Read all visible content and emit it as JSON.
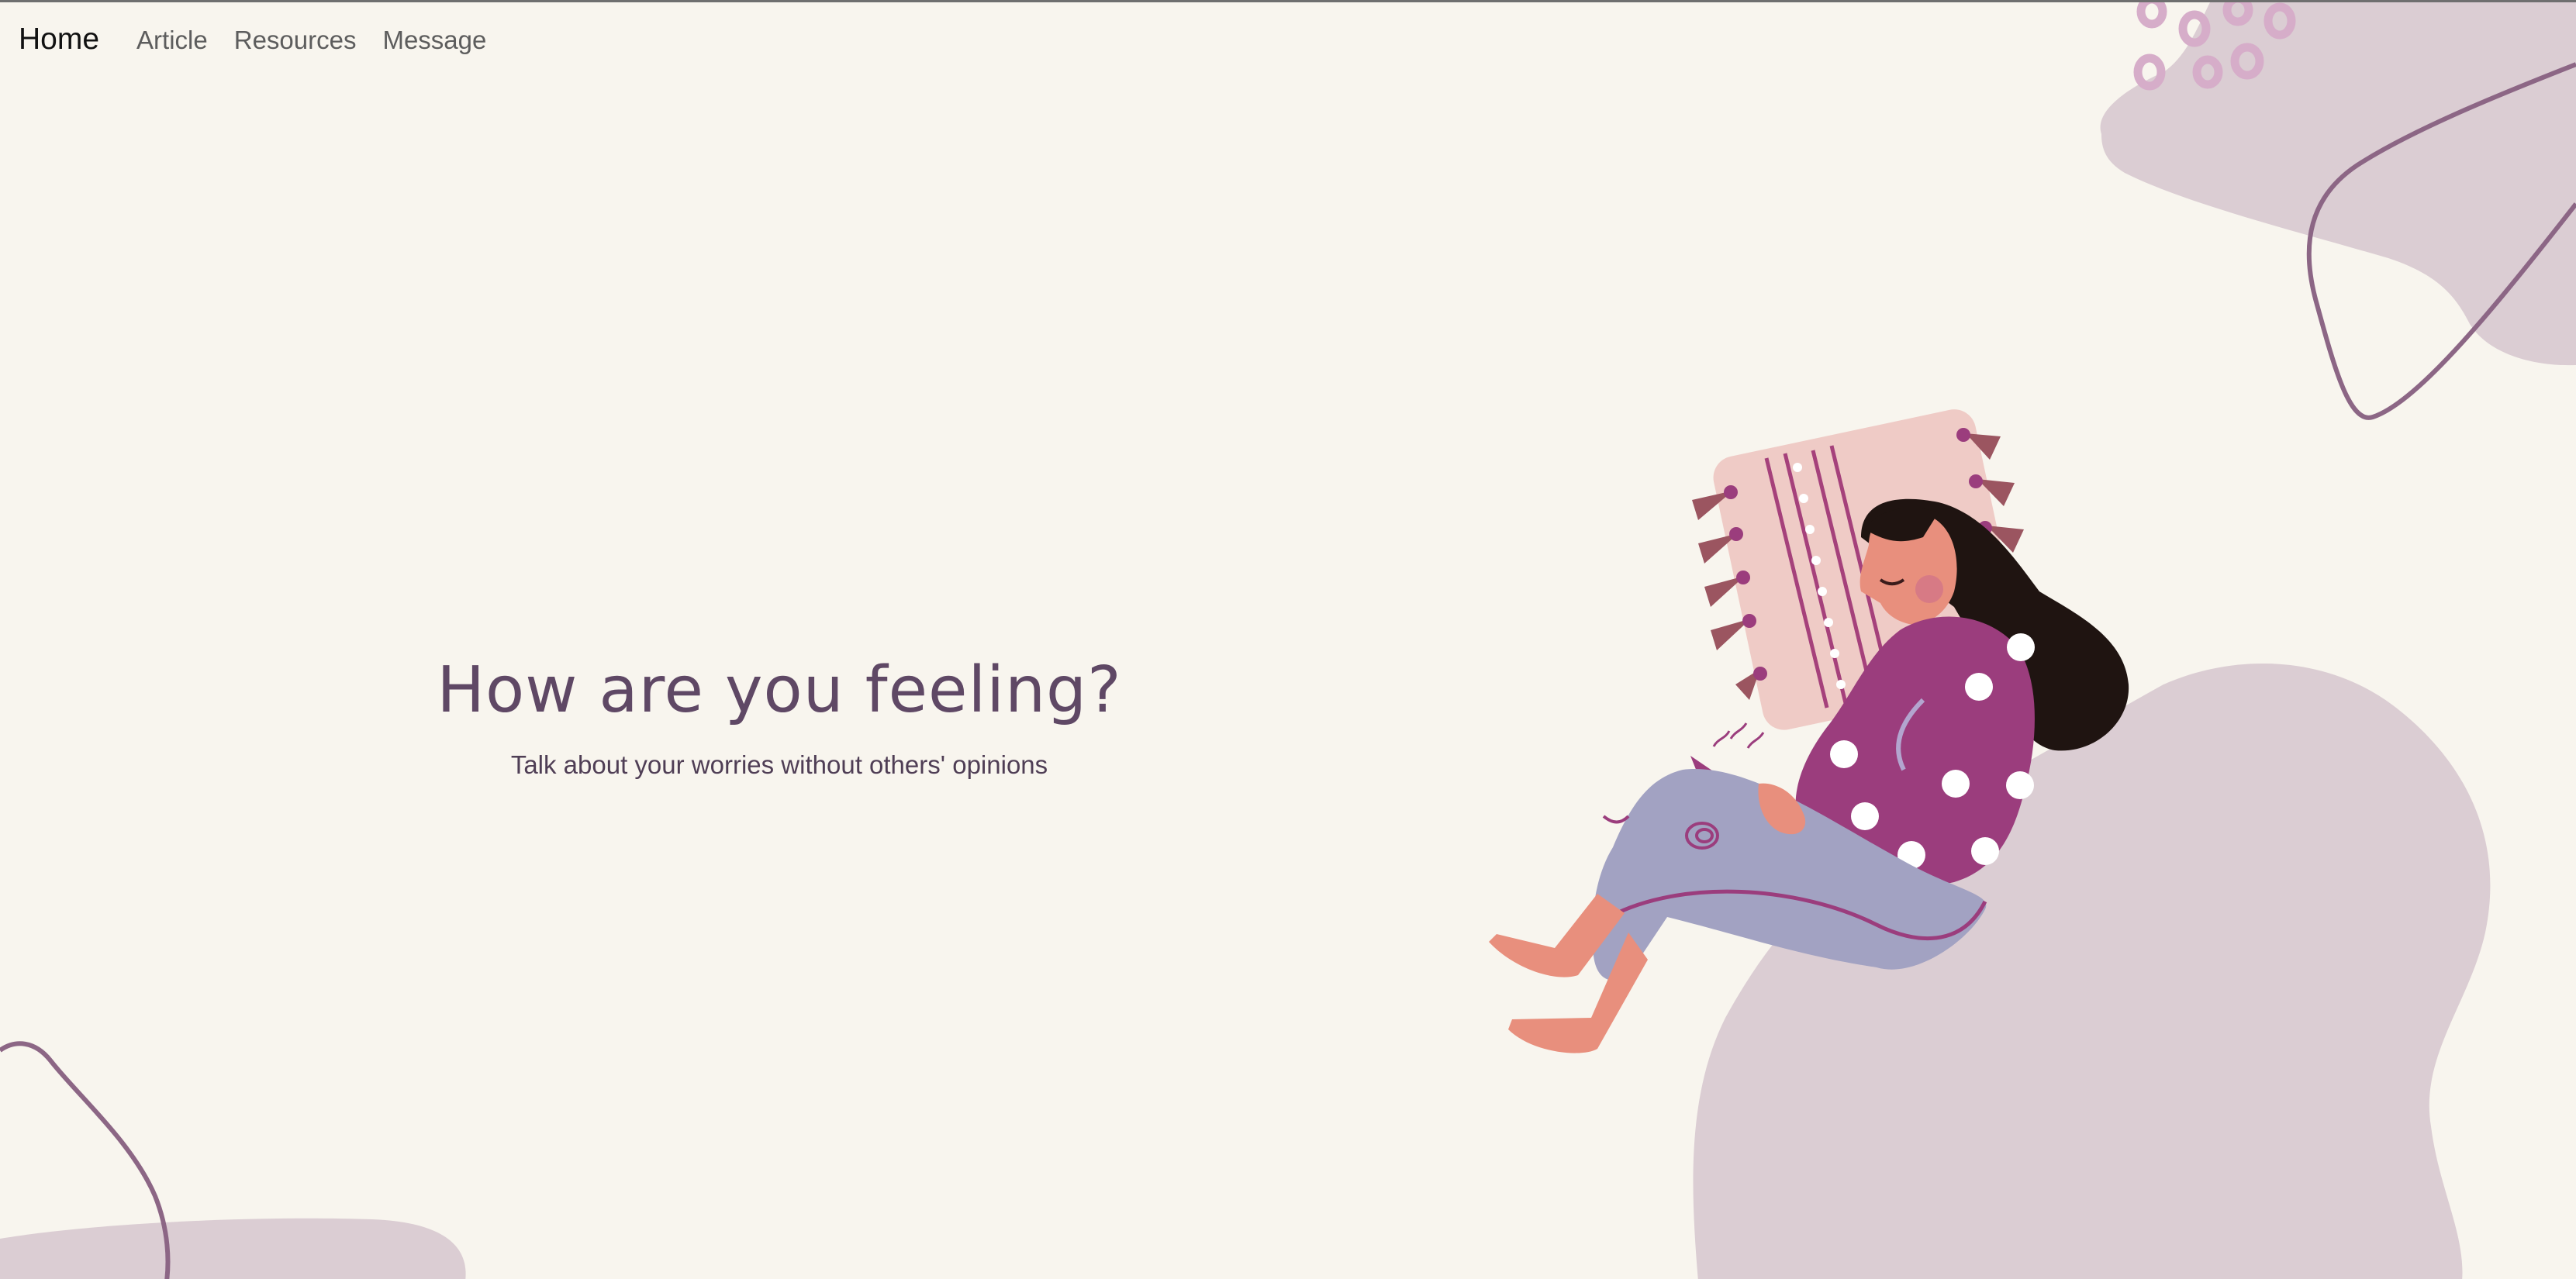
{
  "nav": {
    "home": "Home",
    "items": [
      "Article",
      "Resources",
      "Message"
    ]
  },
  "hero": {
    "title": "How are you feeling?",
    "subtitle": "Talk about your worries without others' opinions"
  },
  "colors": {
    "background": "#f8f5ee",
    "heading": "#5f4865",
    "blob": "#dbcdd3",
    "blob_line": "#8c6685",
    "sweater": "#9b3d7d",
    "pants": "#a2a2c2",
    "skin": "#e88f7d",
    "pillow": "#efcbc6"
  },
  "icons": {
    "top_right_blob": "decorative-blob",
    "bottom_left_blob": "decorative-blob",
    "illustration": "woman-with-pillow-illustration"
  }
}
